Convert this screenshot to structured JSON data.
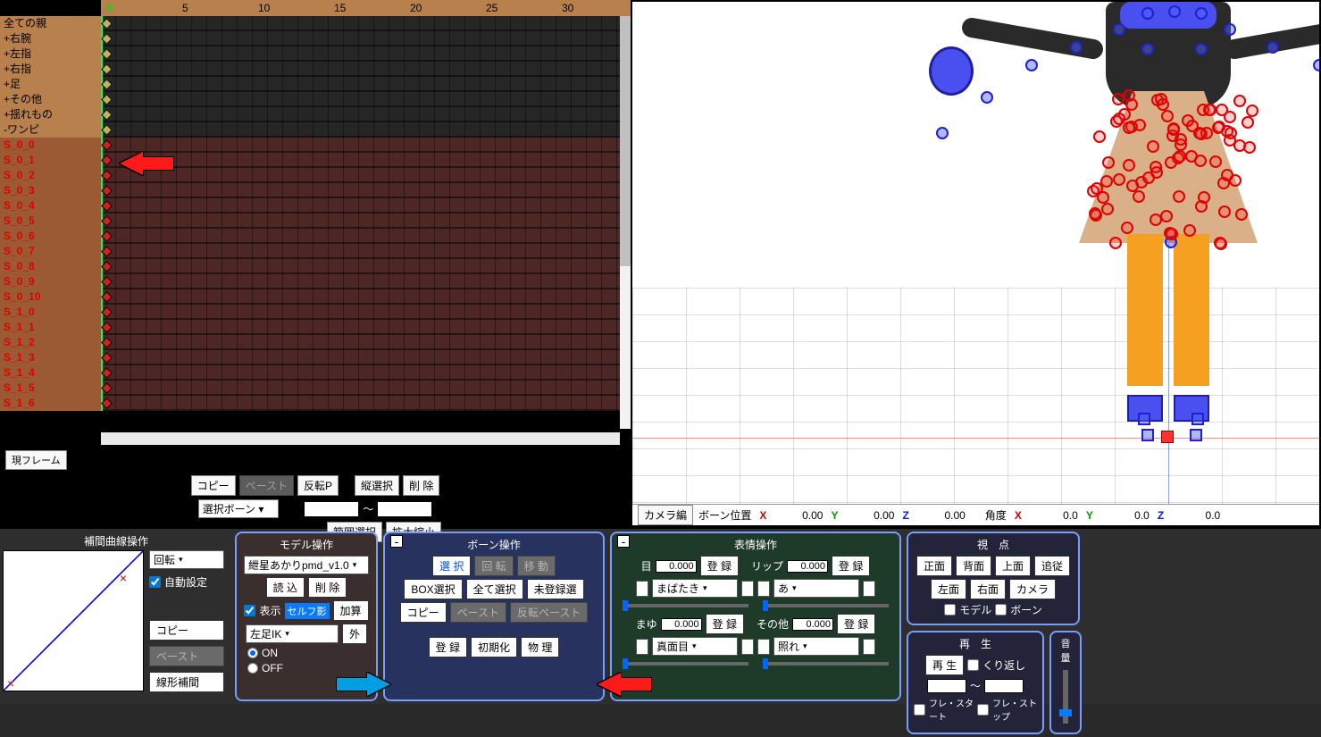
{
  "ruler": {
    "start": 0,
    "ticks": [
      0,
      5,
      10,
      15,
      20,
      25,
      30
    ]
  },
  "bones_std": [
    "全ての親",
    "+右腕",
    "+左指",
    "+右指",
    "+足",
    "+その他",
    "+揺れもの",
    "-ワンピ"
  ],
  "bones_red": [
    "S_0_0",
    "S_0_1",
    "S_0_2",
    "S_0_3",
    "S_0_4",
    "S_0_5",
    "S_0_6",
    "S_0_7",
    "S_0_8",
    "S_0_9",
    "S_0_10",
    "S_1_0",
    "S_1_1",
    "S_1_2",
    "S_1_3",
    "S_1_4",
    "S_1_5",
    "S_1_6"
  ],
  "current_frame_btn": "現フレーム",
  "tl_buttons_row1": {
    "copy": "コピー",
    "paste": "ペースト",
    "flipP": "反転P",
    "vsel": "縦選択",
    "del": "削 除"
  },
  "tl_sel_bone": "選択ボーン",
  "tl_tilde": "～",
  "tl_buttons_row2": {
    "range": "範囲選択",
    "zoom": "拡大縮小"
  },
  "viewport_status": {
    "camera_btn": "カメラ編",
    "bone_pos": "ボーン位置",
    "x": "X",
    "y": "Y",
    "z": "Z",
    "px": "0.00",
    "py": "0.00",
    "pz": "0.00",
    "angle": "角度",
    "ax": "0.0",
    "ay": "0.0",
    "az": "0.0"
  },
  "curve": {
    "title": "補間曲線操作",
    "mode": "回転",
    "auto": "自動設定",
    "copy": "コピー",
    "paste": "ペースト",
    "lerp": "線形補間"
  },
  "model": {
    "title": "モデル操作",
    "name": "紲星あかりpmd_v1.0",
    "load": "読 込",
    "del": "削 除",
    "disp": "表示",
    "selfshadow": "セルフ影",
    "add": "加算",
    "ik": "左足IK",
    "outer": "外",
    "on": "ON",
    "off": "OFF"
  },
  "bone": {
    "title": "ボーン操作",
    "collapse": "-",
    "select": "選 択",
    "rot": "回 転",
    "move": "移 動",
    "box": "BOX選択",
    "all": "全て選択",
    "unreg": "未登録選",
    "copy": "コピー",
    "paste": "ペースト",
    "flip": "反転ペースト",
    "reg": "登 録",
    "init": "初期化",
    "phys": "物 理"
  },
  "face": {
    "title": "表情操作",
    "collapse": "-",
    "eye": "目",
    "eye_v": "0.000",
    "lip": "リップ",
    "lip_v": "0.000",
    "reg": "登 録",
    "blink": "まばたき",
    "lip_a": "あ",
    "brow": "まゆ",
    "brow_v": "0.000",
    "other": "その他",
    "other_v": "0.000",
    "gamen": "真面目",
    "tereru": "照れ"
  },
  "view": {
    "title": "視　点",
    "front": "正面",
    "back": "背面",
    "top": "上面",
    "follow": "追従",
    "left": "左面",
    "right": "右面",
    "camera": "カメラ",
    "model": "モデル",
    "bone": "ボーン",
    "play_title": "再　生",
    "play": "再 生",
    "loop": "くり返し",
    "tilde": "～",
    "framestart": "フレ・スタート",
    "framestop": "フレ・ストップ"
  },
  "volume": "音量"
}
